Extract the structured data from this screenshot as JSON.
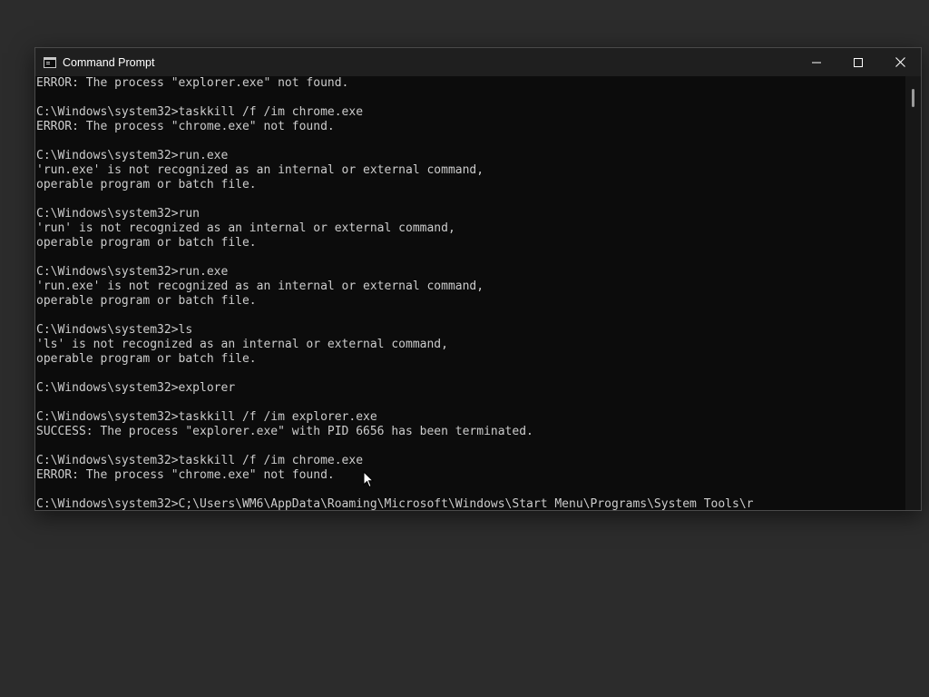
{
  "window": {
    "title": "Command Prompt",
    "controls": {
      "minimize_icon": "minimize-icon",
      "maximize_icon": "maximize-icon",
      "close_icon": "close-icon"
    }
  },
  "console": {
    "foreground": "#cccccc",
    "background": "#0c0c0c",
    "lines": [
      "ERROR: The process \"explorer.exe\" not found.",
      "",
      "C:\\Windows\\system32>taskkill /f /im chrome.exe",
      "ERROR: The process \"chrome.exe\" not found.",
      "",
      "C:\\Windows\\system32>run.exe",
      "'run.exe' is not recognized as an internal or external command,",
      "operable program or batch file.",
      "",
      "C:\\Windows\\system32>run",
      "'run' is not recognized as an internal or external command,",
      "operable program or batch file.",
      "",
      "C:\\Windows\\system32>run.exe",
      "'run.exe' is not recognized as an internal or external command,",
      "operable program or batch file.",
      "",
      "C:\\Windows\\system32>ls",
      "'ls' is not recognized as an internal or external command,",
      "operable program or batch file.",
      "",
      "C:\\Windows\\system32>explorer",
      "",
      "C:\\Windows\\system32>taskkill /f /im explorer.exe",
      "SUCCESS: The process \"explorer.exe\" with PID 6656 has been terminated.",
      "",
      "C:\\Windows\\system32>taskkill /f /im chrome.exe",
      "ERROR: The process \"chrome.exe\" not found.",
      "",
      "C:\\Windows\\system32>C;\\Users\\WM6\\AppData\\Roaming\\Microsoft\\Windows\\Start Menu\\Programs\\System Tools\\r"
    ]
  }
}
